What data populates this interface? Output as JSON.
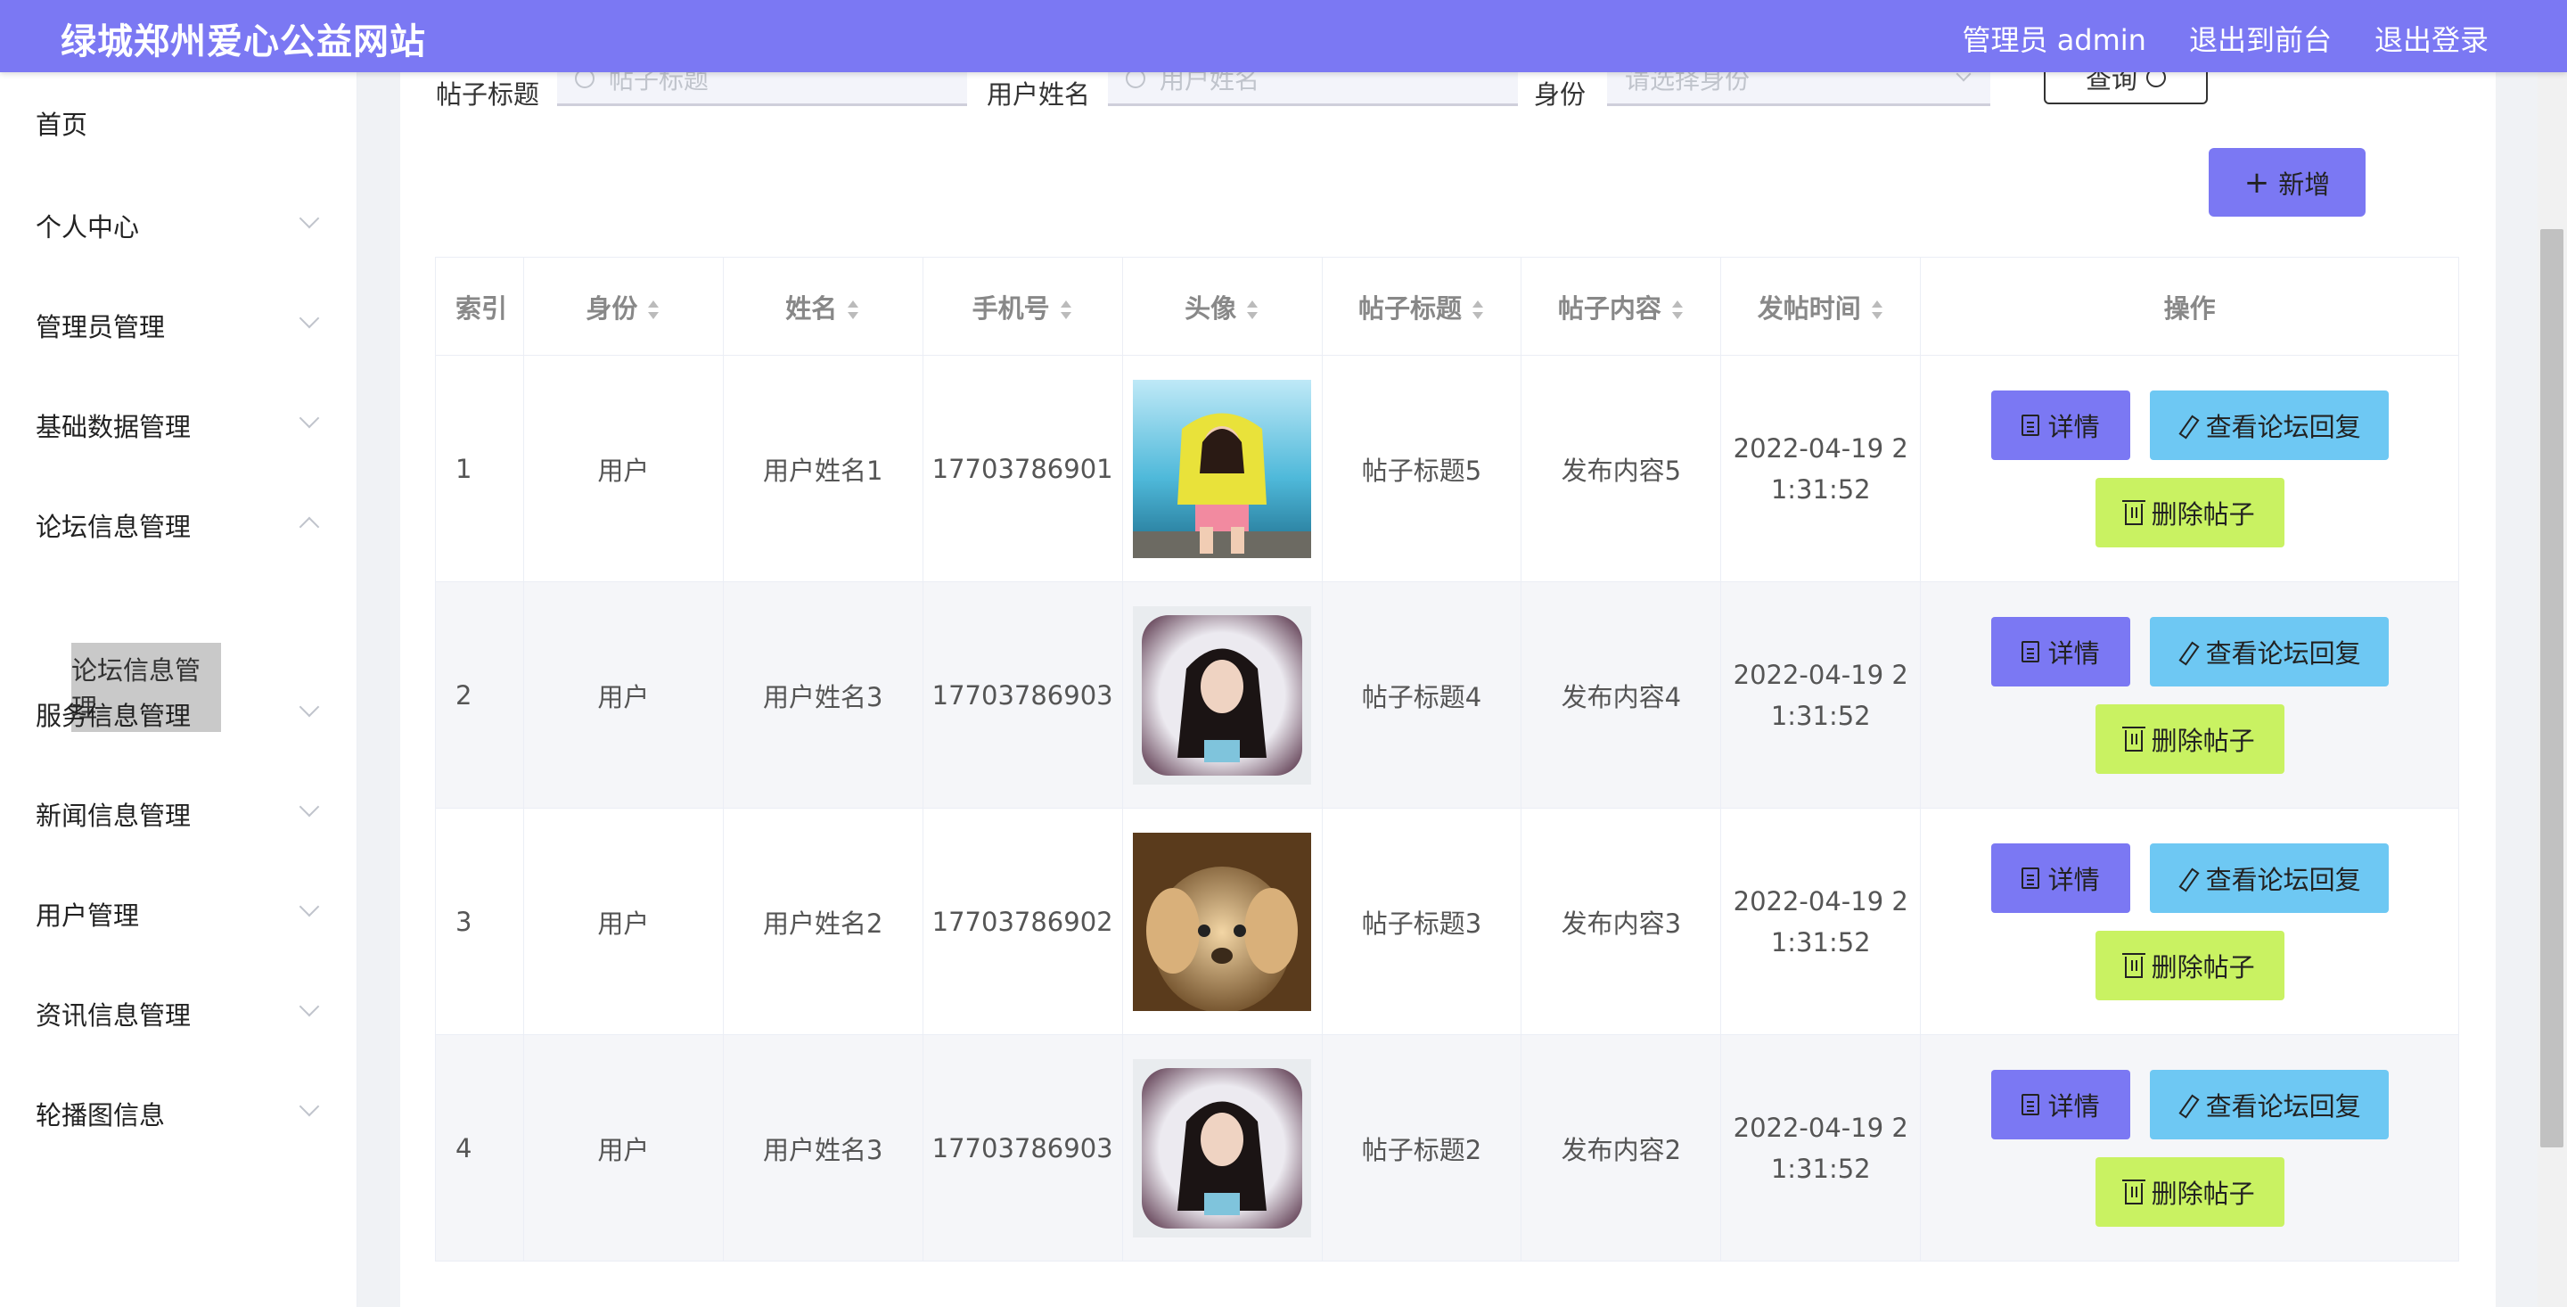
{
  "header": {
    "brand": "绿城郑州爱心公益网站",
    "nav": [
      "管理员 admin",
      "退出到前台",
      "退出登录"
    ]
  },
  "sidebar": {
    "items": [
      {
        "label": "首页",
        "icon": ""
      },
      {
        "label": "个人中心",
        "icon": "chevron-down"
      },
      {
        "label": "管理员管理",
        "icon": "chevron-down"
      },
      {
        "label": "基础数据管理",
        "icon": "chevron-down"
      },
      {
        "label": "论坛信息管理",
        "icon": "chevron-up"
      },
      {
        "label": "服务信息管理",
        "icon": "chevron-down"
      },
      {
        "label": "新闻信息管理",
        "icon": "chevron-down"
      },
      {
        "label": "用户管理",
        "icon": "chevron-down"
      },
      {
        "label": "资讯信息管理",
        "icon": "chevron-down"
      },
      {
        "label": "轮播图信息",
        "icon": "chevron-down"
      }
    ],
    "submenu_active": "论坛信息管理"
  },
  "search": {
    "title_label": "帖子标题",
    "title_placeholder": "帖子标题",
    "user_label": "用户姓名",
    "user_placeholder": "用户姓名",
    "role_label": "身份",
    "role_placeholder": "请选择身份",
    "query_button": "查询"
  },
  "add_button": "新增",
  "table": {
    "headers": [
      "索引",
      "身份",
      "姓名",
      "手机号",
      "头像",
      "帖子标题",
      "帖子内容",
      "发帖时间",
      "操作"
    ],
    "rows": [
      {
        "index": "1",
        "role": "用户",
        "name": "用户姓名1",
        "phone": "17703786901",
        "avatar": "girl-beach",
        "title": "帖子标题5",
        "content": "发布内容5",
        "time1": "2022-04-19 2",
        "time2": "1:31:52"
      },
      {
        "index": "2",
        "role": "用户",
        "name": "用户姓名3",
        "phone": "17703786903",
        "avatar": "woman-pillow",
        "title": "帖子标题4",
        "content": "发布内容4",
        "time1": "2022-04-19 2",
        "time2": "1:31:52"
      },
      {
        "index": "3",
        "role": "用户",
        "name": "用户姓名2",
        "phone": "17703786902",
        "avatar": "puppy",
        "title": "帖子标题3",
        "content": "发布内容3",
        "time1": "2022-04-19 2",
        "time2": "1:31:52"
      },
      {
        "index": "4",
        "role": "用户",
        "name": "用户姓名3",
        "phone": "17703786903",
        "avatar": "woman-pillow",
        "title": "帖子标题2",
        "content": "发布内容2",
        "time1": "2022-04-19 2",
        "time2": "1:31:52"
      }
    ],
    "actions": {
      "detail": "详情",
      "reply": "查看论坛回复",
      "delete": "删除帖子"
    }
  },
  "colors": {
    "accent": "#7b78f3",
    "reply": "#6ec8f3",
    "delete": "#c9f262"
  }
}
